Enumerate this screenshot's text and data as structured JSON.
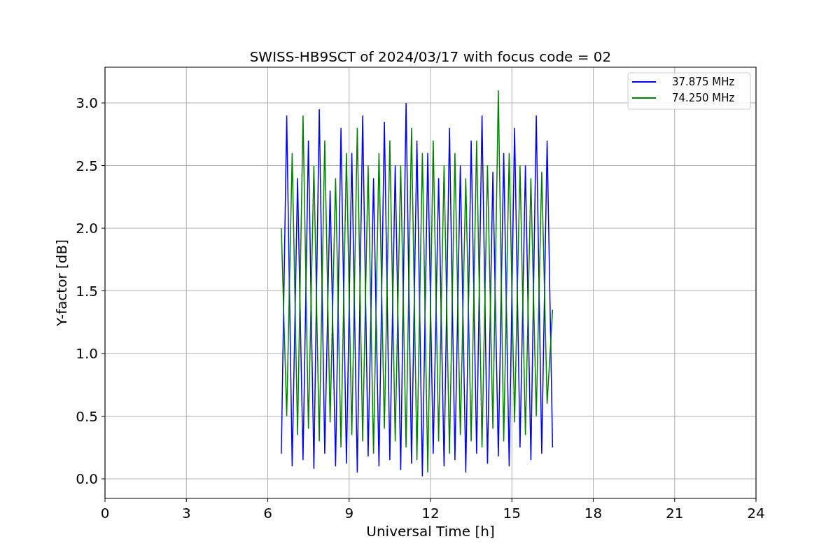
{
  "chart_data": {
    "type": "line",
    "title": "SWISS-HB9SCT of 2024/03/17 with focus code = 02",
    "xlabel": "Universal Time [h]",
    "ylabel": "Y-factor [dB]",
    "x": [
      6.5,
      6.7,
      6.9,
      7.1,
      7.3,
      7.5,
      7.7,
      7.9,
      8.1,
      8.3,
      8.5,
      8.7,
      8.9,
      9.1,
      9.3,
      9.5,
      9.7,
      9.9,
      10.1,
      10.3,
      10.5,
      10.7,
      10.9,
      11.1,
      11.3,
      11.5,
      11.7,
      11.9,
      12.1,
      12.3,
      12.5,
      12.7,
      12.9,
      13.1,
      13.3,
      13.5,
      13.7,
      13.9,
      14.1,
      14.3,
      14.5,
      14.7,
      14.9,
      15.1,
      15.3,
      15.5,
      15.7,
      15.9,
      16.1,
      16.3,
      16.5
    ],
    "series": [
      {
        "name": "37.875 MHz",
        "color": "#0000ff",
        "values": [
          0.2,
          2.9,
          0.1,
          2.4,
          0.15,
          2.7,
          0.08,
          2.95,
          0.2,
          2.3,
          0.1,
          2.8,
          0.12,
          2.6,
          0.05,
          2.9,
          0.18,
          2.4,
          0.1,
          2.85,
          0.15,
          2.5,
          0.07,
          3.0,
          0.12,
          2.7,
          0.02,
          2.6,
          0.2,
          2.4,
          0.1,
          2.8,
          0.15,
          2.5,
          0.05,
          2.7,
          0.2,
          2.9,
          0.12,
          2.45,
          0.18,
          2.6,
          0.1,
          2.8,
          0.25,
          2.5,
          0.15,
          2.9,
          0.2,
          2.7,
          0.25
        ]
      },
      {
        "name": "74.250 MHz",
        "color": "#008000",
        "values": [
          2.0,
          0.5,
          2.6,
          0.35,
          2.9,
          0.4,
          2.5,
          0.3,
          2.7,
          0.45,
          2.4,
          0.25,
          2.6,
          0.35,
          2.8,
          0.3,
          2.5,
          0.2,
          2.6,
          0.4,
          2.7,
          0.3,
          2.5,
          0.25,
          2.8,
          0.15,
          2.6,
          0.05,
          2.7,
          0.3,
          2.5,
          0.2,
          2.6,
          0.35,
          2.4,
          0.3,
          2.7,
          0.25,
          2.5,
          0.4,
          3.1,
          0.3,
          2.6,
          0.45,
          2.5,
          0.35,
          2.4,
          0.5,
          2.45,
          0.6,
          1.35
        ]
      }
    ],
    "grid": true,
    "legend": true,
    "xlim": [
      0,
      24
    ],
    "ylim": [
      -0.156,
      3.285
    ],
    "xticks": [
      0,
      3,
      6,
      9,
      12,
      15,
      18,
      21,
      24
    ],
    "yticks": [
      {
        "value": 0,
        "label": "0.0"
      },
      {
        "value": 0.5,
        "label": "0.5"
      },
      {
        "value": 1,
        "label": "1.0"
      },
      {
        "value": 1.5,
        "label": "1.5"
      },
      {
        "value": 2,
        "label": "2.0"
      },
      {
        "value": 2.5,
        "label": "2.5"
      },
      {
        "value": 3,
        "label": "3.0"
      }
    ]
  }
}
